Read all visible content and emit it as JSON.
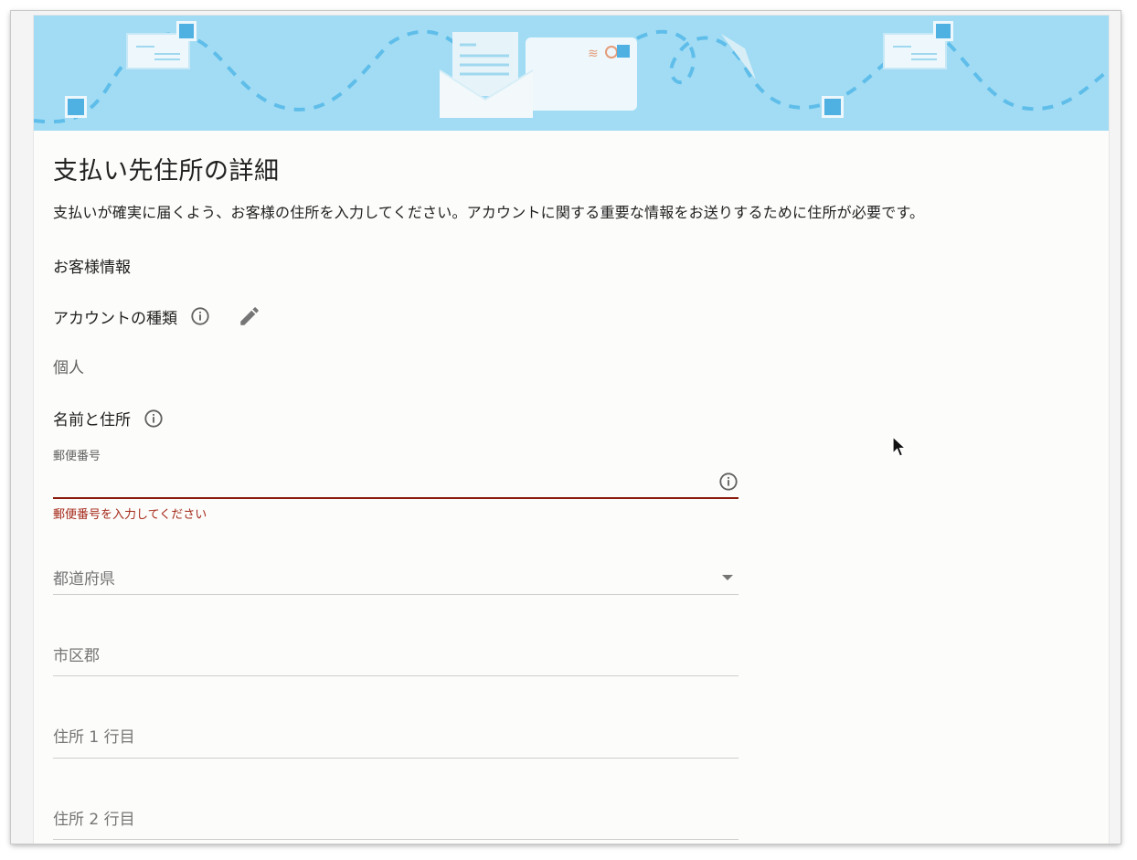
{
  "page": {
    "title": "支払い先住所の詳細",
    "description": "支払いが確実に届くよう、お客様の住所を入力してください。アカウントに関する重要な情報をお送りするために住所が必要です。"
  },
  "customer_info": {
    "heading": "お客様情報",
    "account_type": {
      "label": "アカウントの種類",
      "value": "個人",
      "info_icon": "info-icon",
      "edit_icon": "pencil-icon"
    }
  },
  "name_address": {
    "label": "名前と住所",
    "info_icon": "info-icon",
    "postal_code": {
      "label": "郵便番号",
      "value": "",
      "error": "郵便番号を入力してください"
    },
    "prefecture": {
      "placeholder": "都道府県"
    },
    "city": {
      "placeholder": "市区郡"
    },
    "address_line1": {
      "placeholder": "住所 1 行目"
    },
    "address_line2": {
      "placeholder": "住所 2 行目"
    }
  },
  "colors": {
    "banner": "#a1dcf4",
    "error": "#a5291a",
    "text": "#212121"
  }
}
